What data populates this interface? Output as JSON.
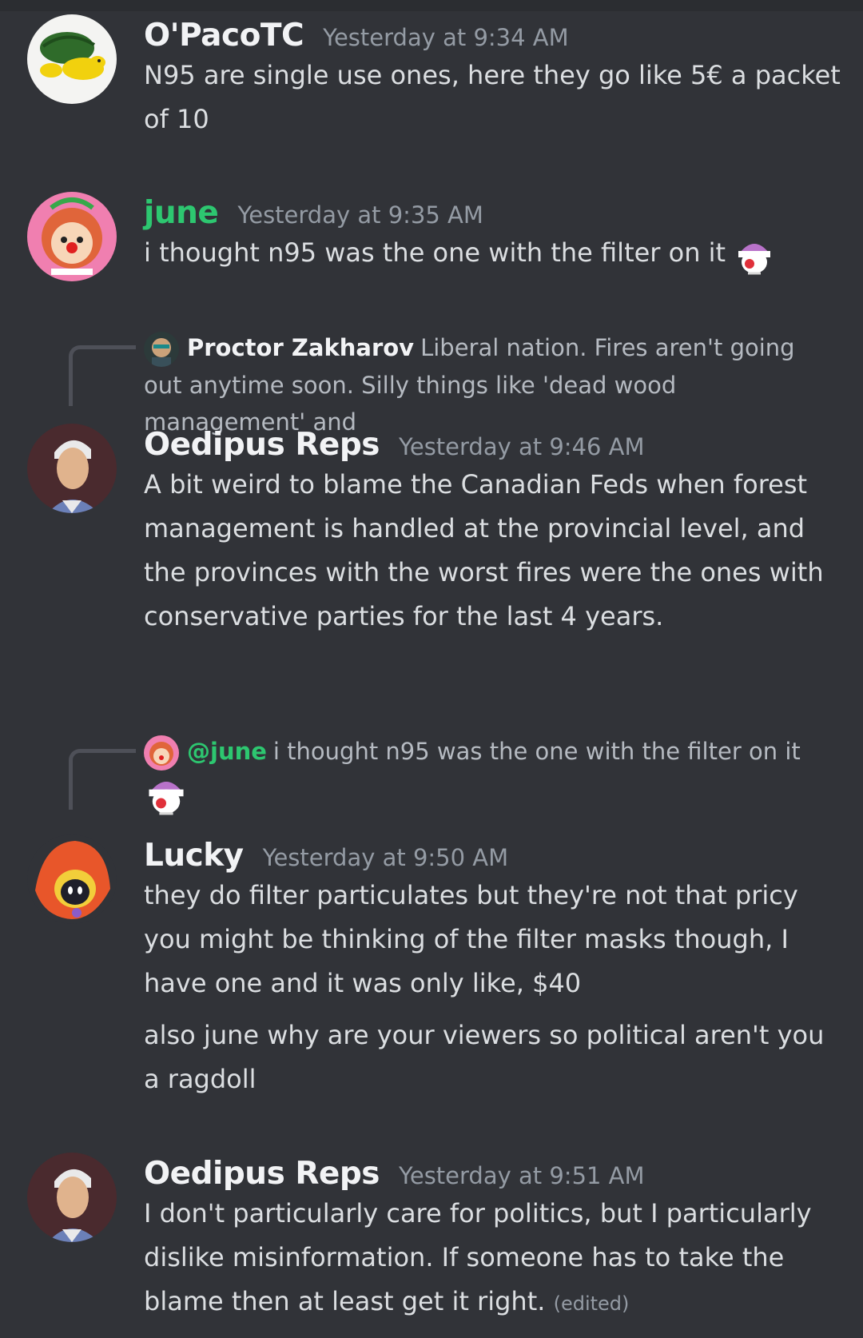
{
  "messages": [
    {
      "username": "O'PacoTC",
      "timestamp": "Yesterday at 9:34 AM",
      "lines": [
        "N95 are single use ones, here they go like 5€ a packet of 10"
      ]
    },
    {
      "username": "june",
      "timestamp": "Yesterday at 9:35 AM",
      "lines": [
        "i thought n95 was the one with the filter on it"
      ]
    },
    {
      "reply": {
        "author": "Proctor Zakharov",
        "text": "Liberal nation. Fires aren't going out anytime soon. Silly things like 'dead wood management' and"
      },
      "username": "Oedipus Reps",
      "timestamp": "Yesterday at 9:46 AM",
      "lines": [
        "A bit weird to blame the Canadian Feds when forest management is handled at the provincial level, and the provinces with the worst fires were the ones with conservative parties for the last 4 years."
      ]
    },
    {
      "reply": {
        "author": "@june",
        "text": "i thought n95 was the one with the filter on it"
      },
      "username": "Lucky",
      "timestamp": "Yesterday at 9:50 AM",
      "lines": [
        "they do filter particulates but they're not that pricy you might be thinking of the filter masks though, I have one and it was only like, $40",
        "also june why are your viewers so political aren't you a ragdoll"
      ]
    },
    {
      "username": "Oedipus Reps",
      "timestamp": "Yesterday at 9:51 AM",
      "lines": [
        "I don't particularly care for politics, but I particularly dislike misinformation. If someone has to take the blame then at least get it right."
      ],
      "edited": "(edited)"
    }
  ],
  "colors": {
    "background": "#313338",
    "text": "#dbdee1",
    "username": "#f2f3f5",
    "mention_green": "#2dc770",
    "timestamp": "#949ba4"
  }
}
